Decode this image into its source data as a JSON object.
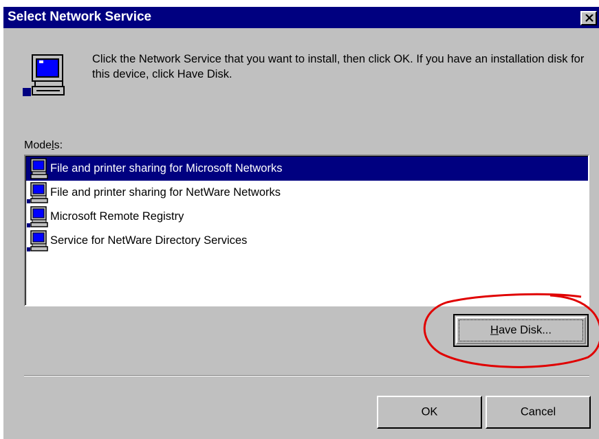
{
  "window": {
    "title": "Select Network Service",
    "close_label": "×"
  },
  "description": "Click the Network Service that you want to install, then click OK. If you have an installation disk for this device, click Have Disk.",
  "models": {
    "label_pre": "Mode",
    "label_accel": "l",
    "label_post": "s:",
    "items": [
      {
        "label": "File and printer sharing for Microsoft Networks",
        "selected": true,
        "icon": "network-computer-icon"
      },
      {
        "label": "File and printer sharing for NetWare Networks",
        "selected": false,
        "icon": "network-computer-icon"
      },
      {
        "label": "Microsoft Remote Registry",
        "selected": false,
        "icon": "network-computer-icon"
      },
      {
        "label": "Service for NetWare Directory Services",
        "selected": false,
        "icon": "network-computer-icon"
      }
    ]
  },
  "buttons": {
    "have_disk_accel": "H",
    "have_disk_rest": "ave Disk...",
    "ok": "OK",
    "cancel": "Cancel"
  },
  "colors": {
    "titlebar": "#000080",
    "dialog": "#c0c0c0",
    "selection": "#000080",
    "annotation": "#e00000"
  }
}
